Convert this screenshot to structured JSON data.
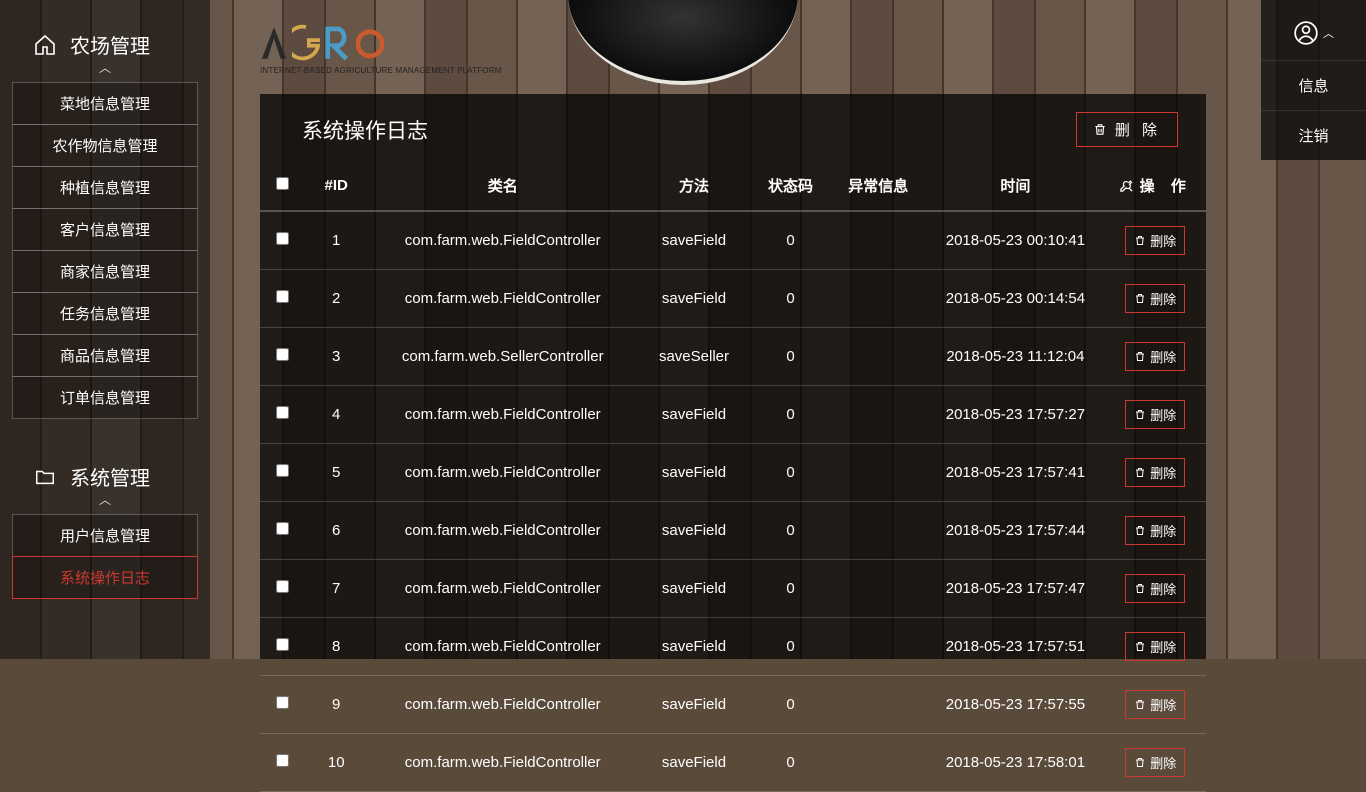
{
  "logo": {
    "subtitle": "INTERNET-BASED AGRICULTURE MANAGEMENT PLATFORM"
  },
  "sidebar": {
    "sections": [
      {
        "title": "农场管理",
        "items": [
          {
            "label": "菜地信息管理"
          },
          {
            "label": "农作物信息管理"
          },
          {
            "label": "种植信息管理"
          },
          {
            "label": "客户信息管理"
          },
          {
            "label": "商家信息管理"
          },
          {
            "label": "任务信息管理"
          },
          {
            "label": "商品信息管理"
          },
          {
            "label": "订单信息管理"
          }
        ]
      },
      {
        "title": "系统管理",
        "items": [
          {
            "label": "用户信息管理"
          },
          {
            "label": "系统操作日志",
            "active": true
          }
        ]
      }
    ]
  },
  "user_menu": {
    "items": [
      {
        "label": "信息"
      },
      {
        "label": "注销"
      }
    ]
  },
  "panel": {
    "title": "系统操作日志",
    "delete_all_label": "删 除",
    "columns": {
      "id": "#ID",
      "class": "类名",
      "method": "方法",
      "status": "状态码",
      "exception": "异常信息",
      "time": "时间",
      "op": "操 作"
    },
    "row_delete_label": "删除",
    "rows": [
      {
        "id": "1",
        "class": "com.farm.web.FieldController",
        "method": "saveField",
        "status": "0",
        "exception": "",
        "time": "2018-05-23 00:10:41"
      },
      {
        "id": "2",
        "class": "com.farm.web.FieldController",
        "method": "saveField",
        "status": "0",
        "exception": "",
        "time": "2018-05-23 00:14:54"
      },
      {
        "id": "3",
        "class": "com.farm.web.SellerController",
        "method": "saveSeller",
        "status": "0",
        "exception": "",
        "time": "2018-05-23 11:12:04"
      },
      {
        "id": "4",
        "class": "com.farm.web.FieldController",
        "method": "saveField",
        "status": "0",
        "exception": "",
        "time": "2018-05-23 17:57:27"
      },
      {
        "id": "5",
        "class": "com.farm.web.FieldController",
        "method": "saveField",
        "status": "0",
        "exception": "",
        "time": "2018-05-23 17:57:41"
      },
      {
        "id": "6",
        "class": "com.farm.web.FieldController",
        "method": "saveField",
        "status": "0",
        "exception": "",
        "time": "2018-05-23 17:57:44"
      },
      {
        "id": "7",
        "class": "com.farm.web.FieldController",
        "method": "saveField",
        "status": "0",
        "exception": "",
        "time": "2018-05-23 17:57:47"
      },
      {
        "id": "8",
        "class": "com.farm.web.FieldController",
        "method": "saveField",
        "status": "0",
        "exception": "",
        "time": "2018-05-23 17:57:51"
      },
      {
        "id": "9",
        "class": "com.farm.web.FieldController",
        "method": "saveField",
        "status": "0",
        "exception": "",
        "time": "2018-05-23 17:57:55"
      },
      {
        "id": "10",
        "class": "com.farm.web.FieldController",
        "method": "saveField",
        "status": "0",
        "exception": "",
        "time": "2018-05-23 17:58:01"
      }
    ]
  }
}
